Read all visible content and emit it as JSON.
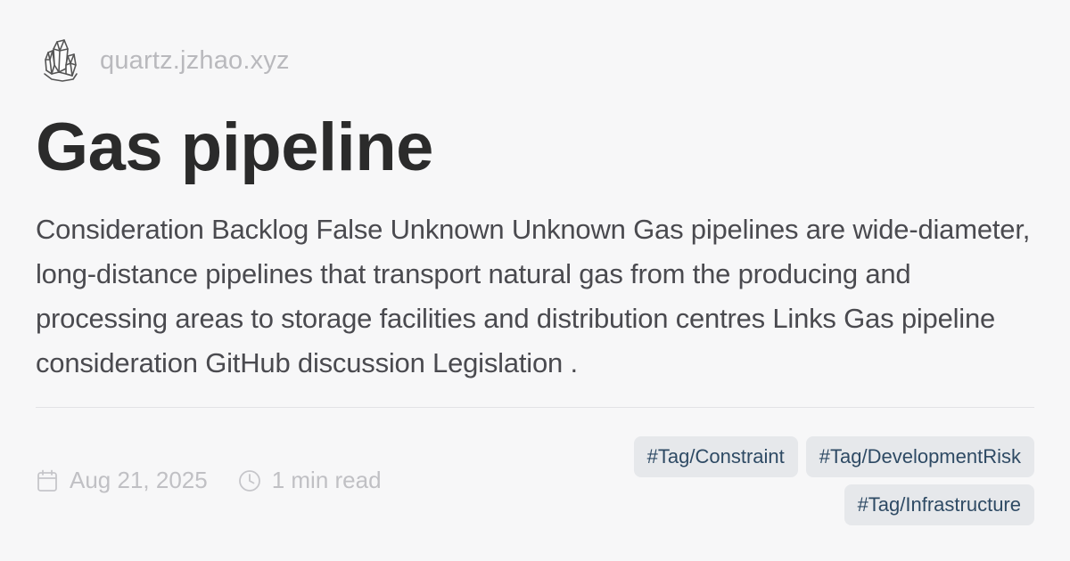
{
  "site": {
    "domain": "quartz.jzhao.xyz",
    "logo_icon": "crystal-cluster-icon"
  },
  "page": {
    "title": "Gas pipeline",
    "description": "Consideration Backlog False Unknown Unknown Gas pipelines are wide-diameter, long-distance pipelines that transport natural gas from the producing and processing areas to storage facilities and distribution centres Links Gas pipeline consideration GitHub discussion Legislation ."
  },
  "meta": {
    "date": "Aug 21, 2025",
    "date_icon": "calendar-icon",
    "read_time": "1 min read",
    "read_time_icon": "clock-icon"
  },
  "tags": [
    {
      "label": "#Tag/Constraint"
    },
    {
      "label": "#Tag/DevelopmentRisk"
    },
    {
      "label": "#Tag/Infrastructure"
    }
  ],
  "colors": {
    "background": "#f7f7f8",
    "title": "#2b2b2b",
    "body_text": "#4a4a4f",
    "muted": "#c0c0c4",
    "tag_bg": "#e6e8eb",
    "tag_text": "#2e4a64"
  }
}
